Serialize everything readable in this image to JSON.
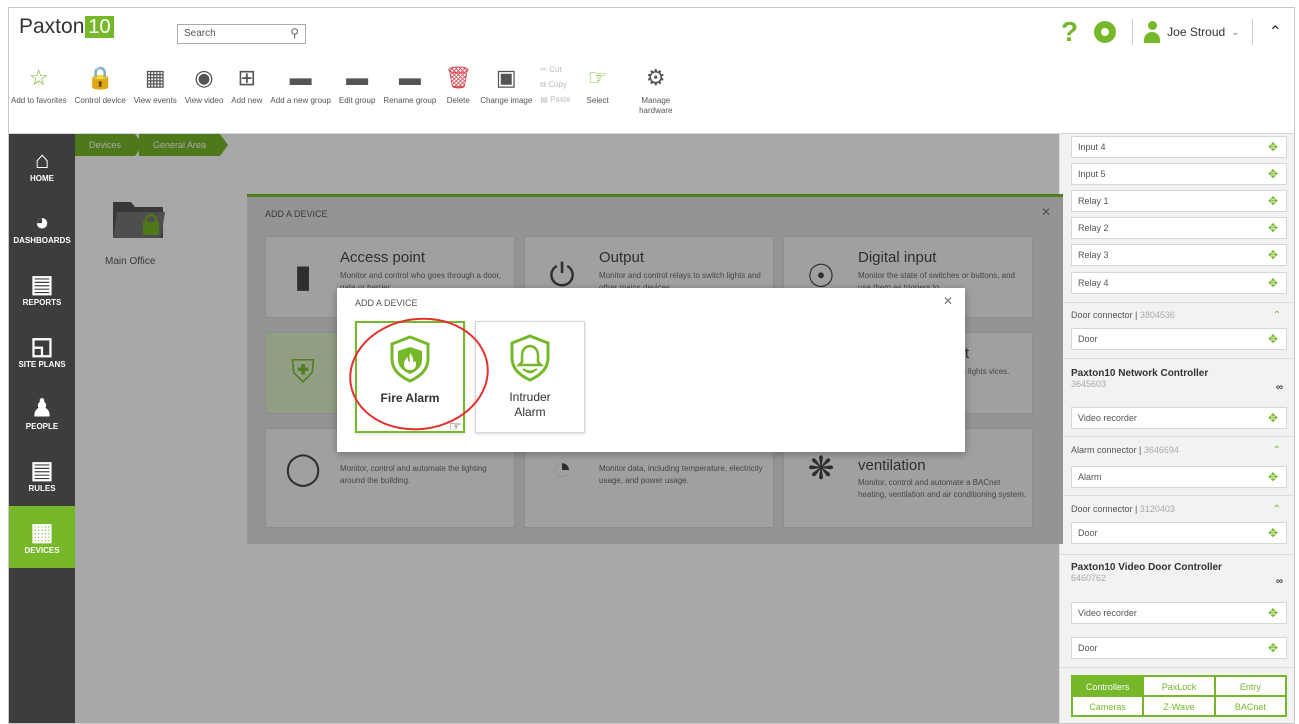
{
  "app": {
    "logo_text": "Paxton",
    "logo_num": "10"
  },
  "search": {
    "placeholder": "Search"
  },
  "user": {
    "name": "Joe Stroud"
  },
  "toolbar": {
    "add_favorites": "Add to favorites",
    "control_device": "Control device",
    "view_events": "View events",
    "view_video": "View video",
    "add_new": "Add new",
    "add_new_group": "Add a new group",
    "edit_group": "Edit group",
    "rename_group": "Rename group",
    "delete": "Delete",
    "change_image": "Change image",
    "cut": "Cut",
    "copy": "Copy",
    "paste": "Paste",
    "select": "Select",
    "manage_hardware": "Manage hardware"
  },
  "sidebar": {
    "items": [
      {
        "label": "HOME",
        "icon": "home-icon"
      },
      {
        "label": "DASHBOARDS",
        "icon": "gauge-icon"
      },
      {
        "label": "REPORTS",
        "icon": "report-icon"
      },
      {
        "label": "SITE PLANS",
        "icon": "floorplan-icon"
      },
      {
        "label": "PEOPLE",
        "icon": "person-icon"
      },
      {
        "label": "RULES",
        "icon": "rules-icon"
      },
      {
        "label": "DEVICES",
        "icon": "devices-icon"
      }
    ]
  },
  "breadcrumb": {
    "items": [
      "Devices",
      "General Area"
    ]
  },
  "folder": {
    "label": "Main Office"
  },
  "right_panel": {
    "inputs": [
      "Input 4",
      "Input 5",
      "Relay 1",
      "Relay 2",
      "Relay 3",
      "Relay 4"
    ],
    "door_connector_1": {
      "label": "Door connector",
      "serial": "3804536",
      "item": "Door"
    },
    "network_controller": {
      "name": "Paxton10 Network Controller",
      "serial": "3645603",
      "item": "Video recorder"
    },
    "alarm_connector": {
      "label": "Alarm connector",
      "serial": "3646694",
      "item": "Alarm"
    },
    "door_connector_2": {
      "label": "Door connector",
      "serial": "3120403",
      "item": "Door"
    },
    "video_door_controller": {
      "name": "Paxton10 Video Door Controller",
      "serial": "6460762",
      "item1": "Video recorder",
      "item2": "Door"
    },
    "tabs": [
      "Controllers",
      "PaxLock",
      "Entry",
      "Cameras",
      "Z-Wave",
      "BACnet"
    ]
  },
  "big_modal": {
    "title": "ADD A DEVICE",
    "cards": [
      {
        "title": "Access point",
        "desc": "Monitor and control who goes through a door, gate or barrier."
      },
      {
        "title": "Output",
        "desc": "Monitor and control relays to switch lights and other mains devices."
      },
      {
        "title": "Digital input",
        "desc": "Monitor the state of switches or buttons, and use them as triggers to"
      },
      {
        "title": "",
        "desc": ""
      },
      {
        "title": "",
        "desc": ""
      },
      {
        "title": "tput",
        "desc": "mable lights vices."
      },
      {
        "title": "",
        "desc": "Monitor, control and automate the lighting around the building."
      },
      {
        "title": "",
        "desc": "Monitor data, including temperature, electricity usage, and power usage."
      },
      {
        "title": "ventilation",
        "desc": "Monitor, control and automate a BACnet heating, ventilation and air conditioning system."
      }
    ]
  },
  "small_modal": {
    "title": "ADD A DEVICE",
    "options": [
      {
        "label": "Fire Alarm",
        "icon": "fire-shield-icon",
        "selected": true
      },
      {
        "label": "Intruder Alarm",
        "icon": "bell-shield-icon",
        "selected": false
      }
    ]
  },
  "colors": {
    "accent": "#76b82a",
    "sidebar": "#3d3d3d",
    "delete": "#d64550",
    "annotation": "#e53030"
  }
}
